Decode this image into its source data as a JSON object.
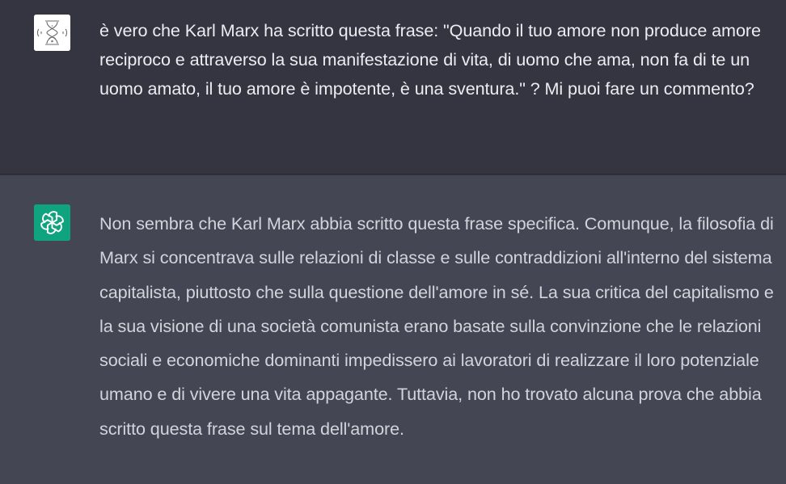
{
  "conversation": {
    "user_message": {
      "avatar_icon": "user-avatar-icon",
      "text": "è vero che Karl Marx ha scritto questa frase: \"Quando il tuo amore non produce amore reciproco e attraverso la sua manifestazione di vita, di uomo che ama, non fa di te un uomo amato, il tuo amore è impotente, è una sventura.\" ? Mi puoi fare un commento?"
    },
    "assistant_message": {
      "avatar_icon": "openai-logo-icon",
      "text": "Non sembra che Karl Marx abbia scritto questa frase specifica. Comunque, la filosofia di Marx si concentrava sulle relazioni di classe e sulle contraddizioni all'interno del sistema capitalista, piuttosto che sulla questione dell'amore in sé. La sua critica del capitalismo e la sua visione di una società comunista erano basate sulla convinzione che le relazioni sociali e economiche dominanti impedissero ai lavoratori di realizzare il loro potenziale umano e di vivere una vita appagante. Tuttavia, non ho trovato alcuna prova che abbia scritto questa frase sul tema dell'amore."
    }
  },
  "colors": {
    "user_background": "#343541",
    "assistant_background": "#444654",
    "openai_avatar": "#10a37f",
    "user_text": "#ececf1",
    "assistant_text": "#d1d5db"
  }
}
